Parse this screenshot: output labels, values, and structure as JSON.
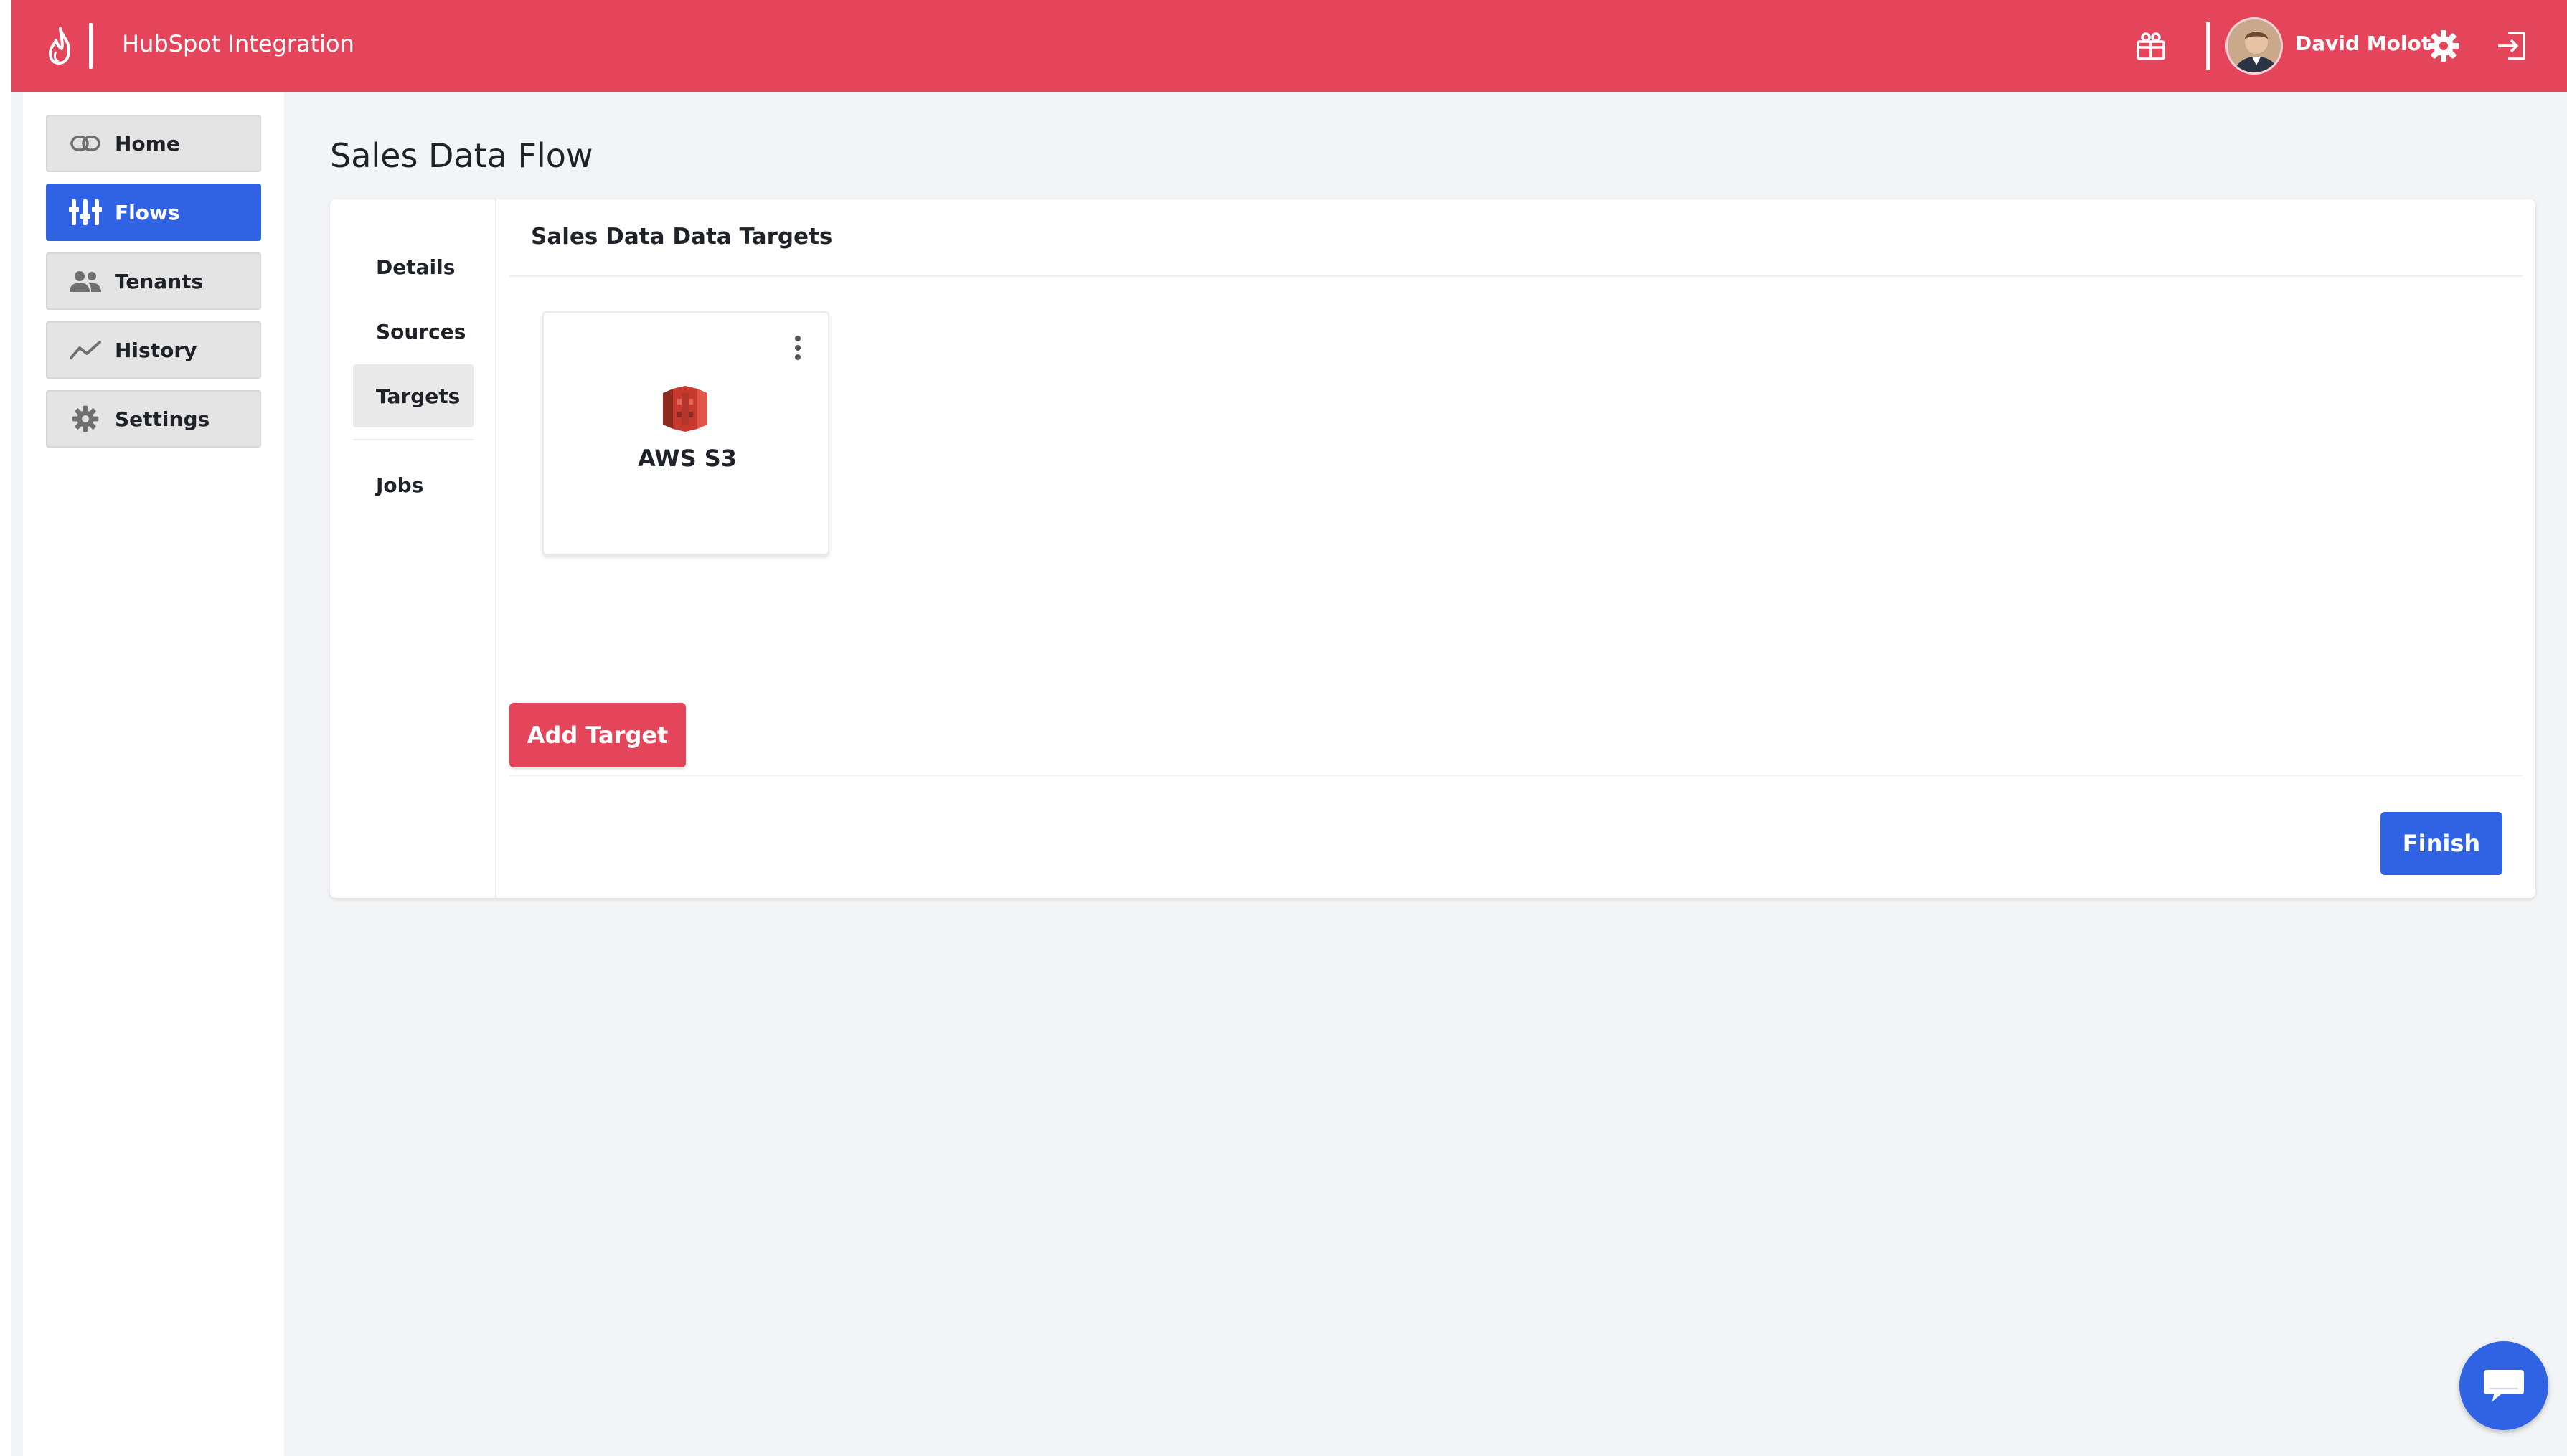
{
  "header": {
    "app_title": "HubSpot Integration",
    "user_name": "David Molot"
  },
  "sidebar": {
    "items": [
      {
        "label": "Home",
        "icon": "link-icon",
        "active": false
      },
      {
        "label": "Flows",
        "icon": "flows-icon",
        "active": true
      },
      {
        "label": "Tenants",
        "icon": "people-icon",
        "active": false
      },
      {
        "label": "History",
        "icon": "chart-line-icon",
        "active": false
      },
      {
        "label": "Settings",
        "icon": "gear-icon",
        "active": false
      }
    ]
  },
  "page": {
    "title": "Sales Data Flow"
  },
  "steps": {
    "items": [
      {
        "label": "Details",
        "active": false
      },
      {
        "label": "Sources",
        "active": false
      },
      {
        "label": "Targets",
        "active": true
      },
      {
        "label": "Jobs",
        "active": false
      }
    ]
  },
  "panel": {
    "title": "Sales Data Data Targets",
    "targets": [
      {
        "name": "AWS S3",
        "icon": "aws-s3-icon"
      }
    ],
    "add_target_label": "Add Target",
    "finish_label": "Finish"
  },
  "colors": {
    "brand_red": "#e5455a",
    "brand_blue": "#2f63e3",
    "background": "#f3f4f6"
  }
}
